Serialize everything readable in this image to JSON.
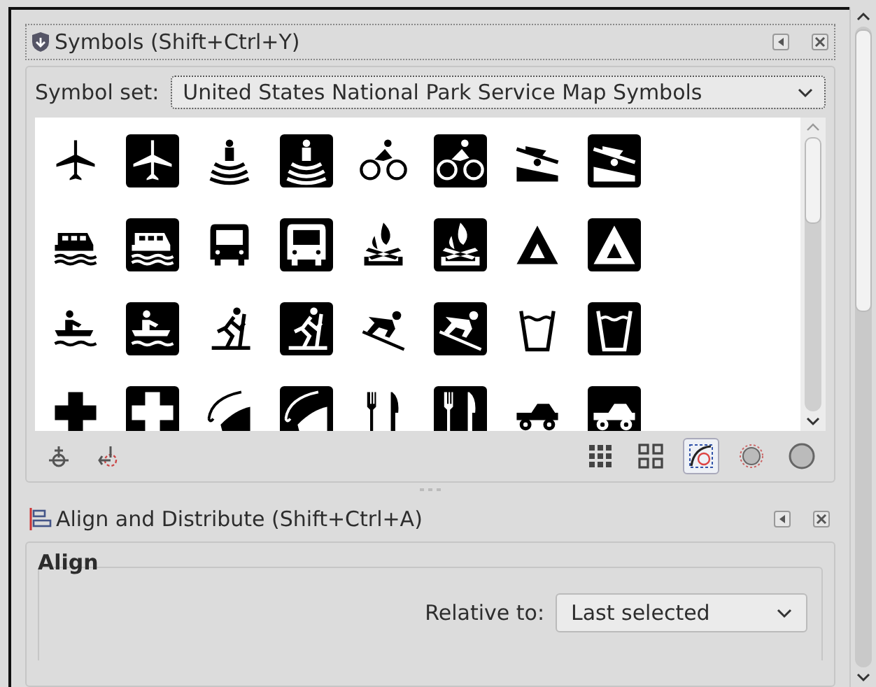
{
  "symbols_panel": {
    "title": "Symbols (Shift+Ctrl+Y)",
    "symbol_set_label": "Symbol set:",
    "symbol_set_value": "United States National Park Service Map Symbols",
    "view_toggles": [
      {
        "selected": false
      },
      {
        "selected": false
      },
      {
        "selected": true
      }
    ]
  },
  "align_panel": {
    "title": "Align and Distribute (Shift+Ctrl+A)",
    "section": "Align",
    "relative_to_label": "Relative to:",
    "relative_to_value": "Last selected"
  }
}
